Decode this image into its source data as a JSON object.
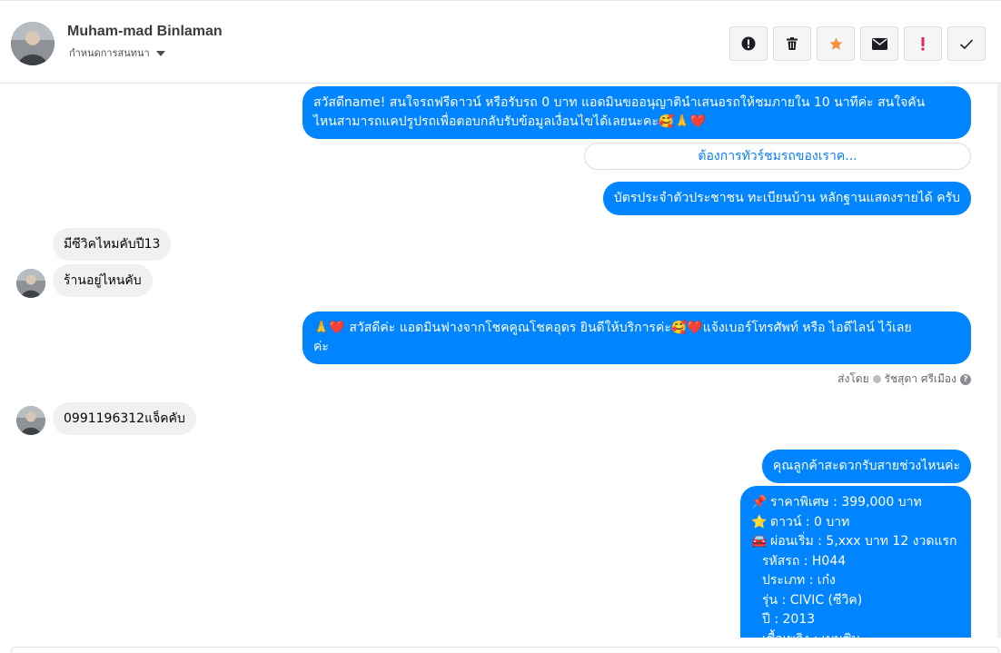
{
  "header": {
    "name": "Muham-mad Binlaman",
    "assign_label": "กำหนดการสนทนา",
    "actions": [
      {
        "name": "spam-button",
        "icon": "exclamation-circle-icon"
      },
      {
        "name": "delete-button",
        "icon": "trash-icon"
      },
      {
        "name": "star-button",
        "icon": "star-icon",
        "color": "#f7923b"
      },
      {
        "name": "unread-button",
        "icon": "envelope-icon"
      },
      {
        "name": "important-button",
        "icon": "exclamation-icon",
        "color": "#e0245e"
      },
      {
        "name": "done-button",
        "icon": "checkmark-icon"
      }
    ]
  },
  "messages": {
    "out1_line1": "สวัสดีname! สนใจรถฟรีดาวน์ หรือรับรถ 0 บาท แอดมินขออนุญาตินำเสนอรถให้ชมภายใน 10 นาทีค่ะ สนใจคัน",
    "out1_line2": "ไหนสามารถแคปรูปรถเพื่อตอบกลับรับข้อมูลเงื่อนไขได้เลยนะคะ🥰🙏❤️",
    "quick_reply": "ต้องการทัวร์ชมรถของเราค...",
    "out2": "บัตรประจำตัวประชาชน ทะเบียนบ้าน หลักฐานแสดงรายได้ ครับ",
    "in1": "มีซีวิคไหมคับปี13",
    "in2": "ร้านอยู่ไหนคับ",
    "out3_line1": "🙏❤️ สวัสดีค่ะ แอดมินฟางจากโชคคูณโชคอุดร ยินดีให้บริการค่ะ🥰❤️แจ้งเบอร์โทรศัพท์ หรือ ไอดีไลน์  ไว้เลย",
    "out3_line2": "ค่ะ",
    "sent_by_label": "ส่งโดย",
    "sent_by_name": "รัชสุดา ศรีเมือง",
    "in3": "0991196312แจ็คคับ",
    "out4": "คุณลูกค้าสะดวกรับสายช่วงไหนค่ะ"
  },
  "card": {
    "price": {
      "emoji": "📌",
      "text": "ราคาพิเศษ : 399,000 บาท"
    },
    "down": {
      "emoji": "⭐",
      "text": "ดาวน์ : 0 บาท"
    },
    "installment": {
      "emoji": "🚘",
      "text": "ผ่อนเริ่ม : 5,xxx บาท 12 งวดแรก"
    },
    "code": "รหัสรถ : H044",
    "type": "ประเภท : เก๋ง",
    "model": "รุ่น : CIVIC (ซีวิค)",
    "year": "ปี : 2013",
    "partial": "เชื้อเพลิง : เบนซิน"
  },
  "colors": {
    "outgoing": "#0084ff",
    "incoming": "#f0f0f0",
    "link": "#0a7cff"
  }
}
